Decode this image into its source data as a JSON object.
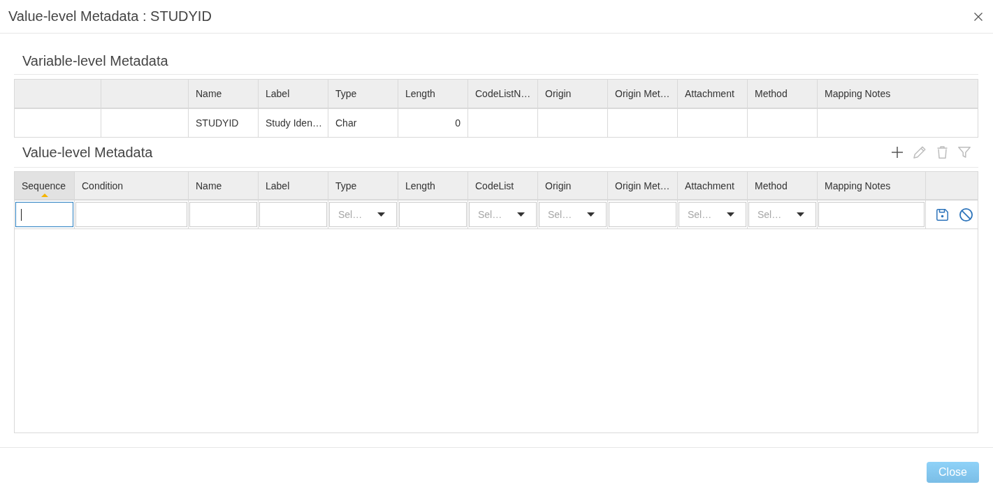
{
  "dialog": {
    "title": "Value-level Metadata : STUDYID"
  },
  "variable_section": {
    "heading": "Variable-level Metadata",
    "columns": [
      {
        "kind": "blank"
      },
      {
        "kind": "blank"
      },
      {
        "kind": "text",
        "label": "Name"
      },
      {
        "kind": "text",
        "label": "Label"
      },
      {
        "kind": "text",
        "label": "Type"
      },
      {
        "kind": "number",
        "label": "Length"
      },
      {
        "kind": "text",
        "label": "CodeListN…"
      },
      {
        "kind": "text",
        "label": "Origin"
      },
      {
        "kind": "text",
        "label": "Origin Met…"
      },
      {
        "kind": "text",
        "label": "Attachment"
      },
      {
        "kind": "text",
        "label": "Method"
      },
      {
        "kind": "text",
        "label": "Mapping Notes"
      }
    ],
    "rows": [
      {
        "cells": [
          null,
          null,
          "STUDYID",
          "Study Iden…",
          "Char",
          "0",
          null,
          null,
          null,
          null,
          null,
          null
        ]
      }
    ]
  },
  "value_section": {
    "heading": "Value-level Metadata",
    "toolbar": [
      {
        "kind": "add",
        "disabled": false
      },
      {
        "kind": "edit",
        "disabled": true
      },
      {
        "kind": "delete",
        "disabled": true
      },
      {
        "kind": "filter",
        "disabled": true
      }
    ],
    "columns": [
      {
        "kind": "text",
        "label": "Sequence",
        "sorted": true
      },
      {
        "kind": "text",
        "label": "Condition",
        "sorted": false
      },
      {
        "kind": "text",
        "label": "Name",
        "sorted": false
      },
      {
        "kind": "text",
        "label": "Label",
        "sorted": false
      },
      {
        "kind": "text",
        "label": "Type",
        "sorted": false
      },
      {
        "kind": "text",
        "label": "Length",
        "sorted": false
      },
      {
        "kind": "text",
        "label": "CodeList",
        "sorted": false
      },
      {
        "kind": "text",
        "label": "Origin",
        "sorted": false
      },
      {
        "kind": "text",
        "label": "Origin Met…",
        "sorted": false
      },
      {
        "kind": "text",
        "label": "Attachment",
        "sorted": false
      },
      {
        "kind": "text",
        "label": "Method",
        "sorted": false
      },
      {
        "kind": "text",
        "label": "Mapping Notes",
        "sorted": false
      },
      {
        "kind": "blank",
        "sorted": false
      }
    ],
    "edit_row": [
      {
        "kind": "input",
        "focused": true
      },
      {
        "kind": "input",
        "focused": false
      },
      {
        "kind": "input",
        "focused": false
      },
      {
        "kind": "input",
        "focused": false
      },
      {
        "kind": "select",
        "placeholder": "Sel…"
      },
      {
        "kind": "input",
        "focused": false
      },
      {
        "kind": "select",
        "placeholder": "Sel…"
      },
      {
        "kind": "select",
        "placeholder": "Sel…"
      },
      {
        "kind": "input",
        "focused": false
      },
      {
        "kind": "select",
        "placeholder": "Sel…"
      },
      {
        "kind": "select",
        "placeholder": "Sel…"
      },
      {
        "kind": "input",
        "focused": false
      },
      {
        "kind": "actions"
      }
    ]
  },
  "footer": {
    "close_button": {
      "label": "Close",
      "disabled": true
    }
  }
}
